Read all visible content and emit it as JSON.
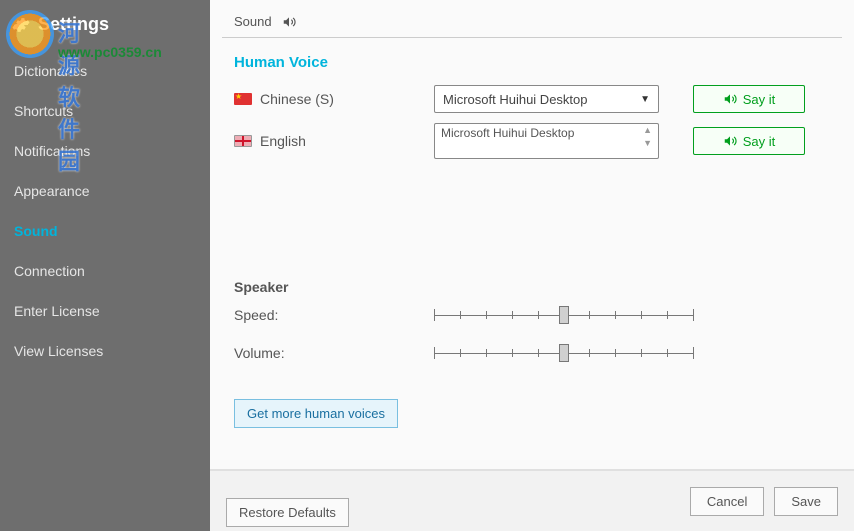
{
  "sidebar": {
    "title": "Settings",
    "items": [
      {
        "label": "Dictionaries"
      },
      {
        "label": "Shortcuts"
      },
      {
        "label": "Notifications"
      },
      {
        "label": "Appearance"
      },
      {
        "label": "Sound"
      },
      {
        "label": "Connection"
      },
      {
        "label": "Enter License"
      },
      {
        "label": "View Licenses"
      }
    ],
    "active_index": 4
  },
  "header": {
    "title": "Sound"
  },
  "human_voice": {
    "section_title": "Human Voice",
    "rows": [
      {
        "language": "Chinese (S)",
        "flag": "cn",
        "voice": "Microsoft Huihui Desktop",
        "control": "dropdown"
      },
      {
        "language": "English",
        "flag": "gb",
        "voice": "Microsoft Huihui Desktop",
        "control": "listbox"
      }
    ],
    "say_it_label": "Say it"
  },
  "speaker": {
    "section_title": "Speaker",
    "speed_label": "Speed:",
    "volume_label": "Volume:",
    "speed_percent": 50,
    "volume_percent": 50
  },
  "buttons": {
    "get_more": "Get more human voices",
    "restore": "Restore Defaults",
    "cancel": "Cancel",
    "save": "Save"
  },
  "watermark": {
    "text": "河源软件园",
    "url": "www.pc0359.cn"
  }
}
